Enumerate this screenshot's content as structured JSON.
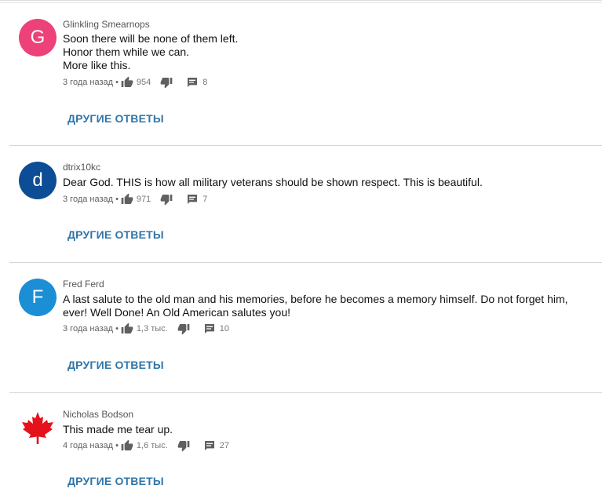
{
  "comments": [
    {
      "author": "Glinkling Smearnops",
      "avatar_letter": "G",
      "avatar_color": "#ec4179",
      "lines": [
        "Soon there will be none of them left.",
        "Honor them while we can.",
        "More like this."
      ],
      "time": "3 года назад",
      "likes": "954",
      "replies": "8",
      "more_label": "ДРУГИЕ ОТВЕТЫ"
    },
    {
      "author": "dtrix10kc",
      "avatar_letter": "d",
      "avatar_color": "#0d4d96",
      "lines": [
        "Dear God. THIS is how all military veterans should be shown respect.  This is beautiful."
      ],
      "time": "3 года назад",
      "likes": "971",
      "replies": "7",
      "more_label": "ДРУГИЕ ОТВЕТЫ"
    },
    {
      "author": "Fred Ferd",
      "avatar_letter": "F",
      "avatar_color": "#1b8fd6",
      "lines": [
        "A last salute to the old man and his memories, before he becomes a memory himself.  Do not forget him,",
        "ever!   Well Done!  An Old American salutes you!"
      ],
      "time": "3 года назад",
      "likes": "1,3 тыс.",
      "replies": "10",
      "more_label": "ДРУГИЕ ОТВЕТЫ"
    },
    {
      "author": "Nicholas Bodson",
      "avatar_icon": "maple-leaf-icon",
      "avatar_color": "#e3121b",
      "lines": [
        "This made me tear up."
      ],
      "time": "4 года назад",
      "likes": "1,6 тыс.",
      "replies": "27",
      "more_label": "ДРУГИЕ ОТВЕТЫ"
    }
  ],
  "icons": {
    "like": "thumbs-up-icon",
    "dislike": "thumbs-down-icon",
    "reply": "comment-icon"
  },
  "colors": {
    "link": "#2f75a8",
    "meta": "#606060"
  }
}
